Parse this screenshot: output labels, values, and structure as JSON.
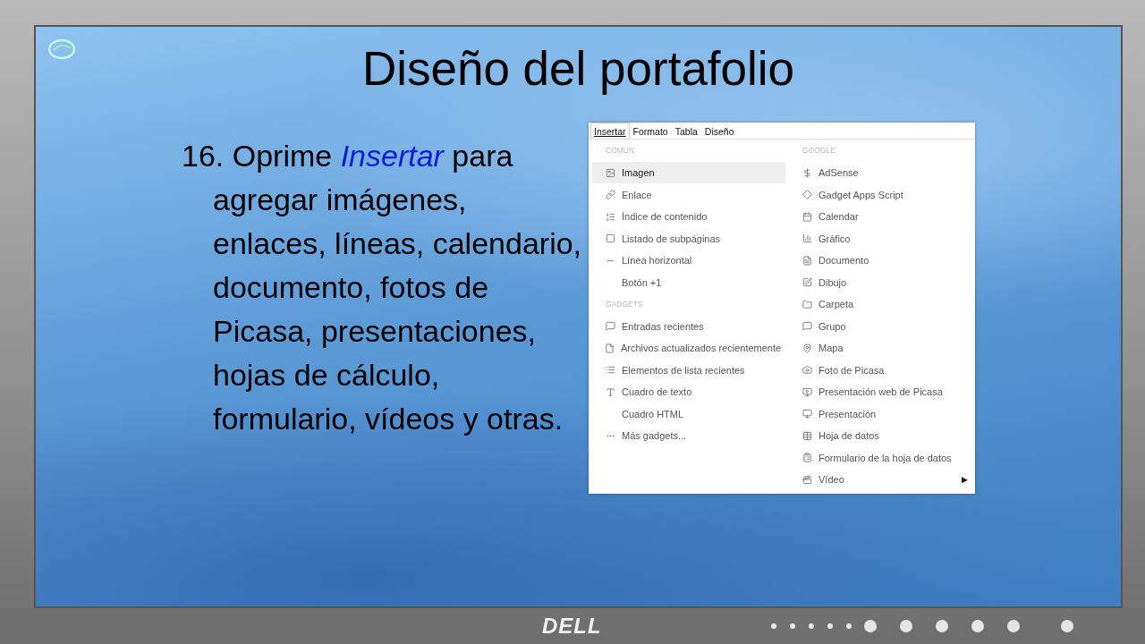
{
  "slide": {
    "title": "Diseño del portafolio",
    "paragraph": "16. Oprime *Insertar* para agregar imágenes, enlaces, líneas, calendario, documento, fotos de Picasa, presentaciones, hojas de cálculo, formulario, vídeos y otras."
  },
  "menu": {
    "menubar": [
      {
        "label": "Insertar",
        "selected": true
      },
      {
        "label": "Formato",
        "selected": false
      },
      {
        "label": "Tabla",
        "selected": false
      },
      {
        "label": "Diseño",
        "selected": false
      }
    ],
    "columns": [
      {
        "sections": [
          {
            "heading": "COMÚN",
            "items": [
              {
                "label": "Imagen",
                "selected": true
              },
              {
                "label": "Enlace",
                "selected": false
              },
              {
                "label": "Índice de contenido",
                "selected": false
              },
              {
                "label": "Listado de subpáginas",
                "selected": false
              },
              {
                "label": "Línea horizontal",
                "selected": false
              },
              {
                "label": "Botón +1",
                "selected": false
              }
            ]
          },
          {
            "heading": "GADGETS",
            "items": [
              {
                "label": "Entradas recientes",
                "selected": false
              },
              {
                "label": "Archivos actualizados recientemente",
                "selected": false
              },
              {
                "label": "Elementos de lista recientes",
                "selected": false
              },
              {
                "label": "Cuadro de texto",
                "selected": false
              },
              {
                "label": "Cuadro HTML",
                "selected": false
              },
              {
                "label": "Más gadgets...",
                "selected": false
              }
            ]
          }
        ]
      },
      {
        "sections": [
          {
            "heading": "GOOGLE",
            "items": [
              {
                "label": "AdSense",
                "selected": false
              },
              {
                "label": "Gadget Apps Script",
                "selected": false
              },
              {
                "label": "Calendar",
                "selected": false
              },
              {
                "label": "Gráfico",
                "selected": false
              },
              {
                "label": "Documento",
                "selected": false
              },
              {
                "label": "Dibujo",
                "selected": false
              },
              {
                "label": "Carpeta",
                "selected": false
              },
              {
                "label": "Grupo",
                "selected": false
              },
              {
                "label": "Mapa",
                "selected": false
              },
              {
                "label": "Foto de Picasa",
                "selected": false
              },
              {
                "label": "Presentación web de Picasa",
                "selected": false
              },
              {
                "label": "Presentación",
                "selected": false
              },
              {
                "label": "Hoja de datos",
                "selected": false
              },
              {
                "label": "Formulario de la hoja de datos",
                "selected": false
              },
              {
                "label": "Vídeo",
                "selected": false,
                "arrow": "▶"
              }
            ]
          }
        ]
      }
    ]
  },
  "monitor": {
    "brand": "DELL"
  }
}
